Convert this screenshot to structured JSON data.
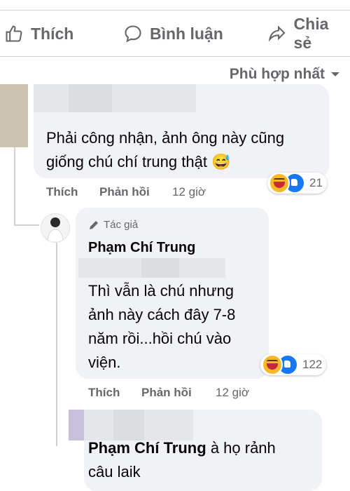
{
  "actions": {
    "like": "Thích",
    "comment": "Bình luận",
    "share": "Chia sẻ"
  },
  "sort_label": "Phù hợp nhất",
  "comments": [
    {
      "text_line1": "Phải công nhận, ảnh ông này cũng",
      "text_line2": "giống chú chí trung thật 😅",
      "like": "Thích",
      "reply": "Phản hồi",
      "time": "12 giờ",
      "reaction_count": "21"
    },
    {
      "author_badge": "Tác giả",
      "name": "Phạm Chí Trung",
      "text_line1": "Thì vẫn là chú nhưng",
      "text_line2": "ảnh này cách đây 7-8",
      "text_line3": "năm rồi...hồi chú vào",
      "text_line4": "viện.",
      "like": "Thích",
      "reply": "Phản hồi",
      "time": "12 giờ",
      "reaction_count": "122"
    },
    {
      "name": "Phạm Chí Trung",
      "text_inline": "à họ rảnh",
      "text_line2": "câu laik"
    }
  ],
  "colors": {
    "meta": "#65676b",
    "bubble": "#f0f2f5",
    "like_blue": "#1877f2",
    "haha_yellow": "#f7b928"
  }
}
